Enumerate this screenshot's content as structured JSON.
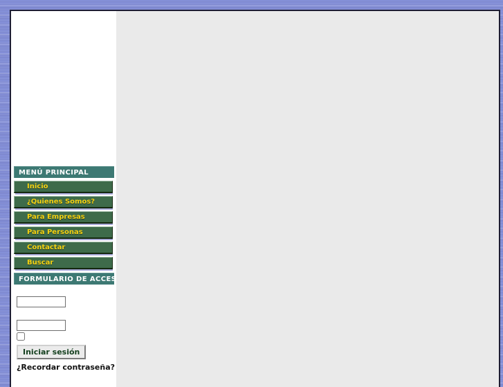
{
  "page": {
    "background_color": "#7f8bd6",
    "content_background_color": "#eaeaea",
    "accent_header_color": "#3d7973",
    "menu_button_color": "#3e6b4a",
    "menu_text_color": "#f5d312"
  },
  "sidebar": {
    "menu_module": {
      "title": "MENÚ PRINCIPAL",
      "items": [
        {
          "label": "Inicio"
        },
        {
          "label": "¿Quienes Somos?"
        },
        {
          "label": "Para Empresas"
        },
        {
          "label": "Para Personas"
        },
        {
          "label": "Contactar"
        },
        {
          "label": "Buscar"
        }
      ]
    },
    "login_module": {
      "title": "FORMULARIO DE ACCESO",
      "username_label": "",
      "username_value": "",
      "username_placeholder": "",
      "password_label": "",
      "password_value": "",
      "password_placeholder": "",
      "remember_label": "",
      "remember_checked": false,
      "submit_label": "Iniciar sesión",
      "forgot_password_label": "¿Recordar contraseña?"
    }
  },
  "main": {
    "content_text": ""
  }
}
